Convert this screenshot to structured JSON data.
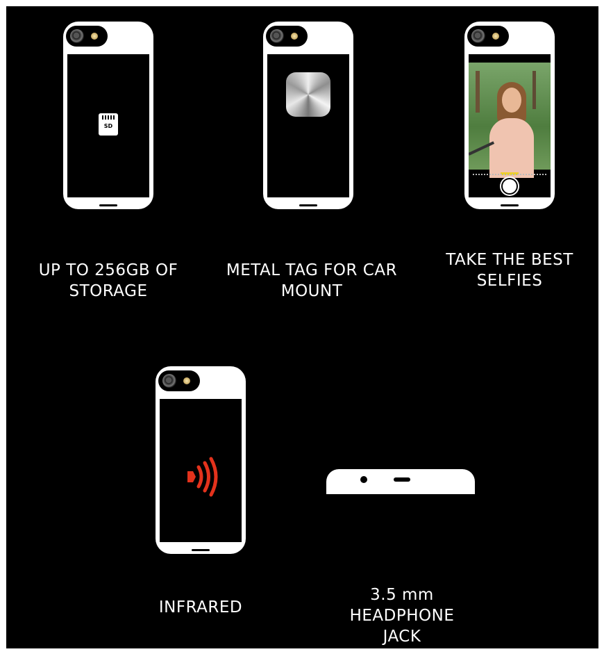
{
  "features": [
    {
      "caption_line1": "UP TO 256GB OF",
      "caption_line2": "STORAGE",
      "icon": "sd-card-icon",
      "sd_label": "SD"
    },
    {
      "caption_line1": "METAL TAG FOR CAR",
      "caption_line2": "MOUNT",
      "icon": "metal-tag-icon"
    },
    {
      "caption_line1": "TAKE THE BEST",
      "caption_line2": "SELFIES",
      "icon": "camera-selfie-screen"
    },
    {
      "caption_line1": "INFRARED",
      "icon": "infrared-signal-icon",
      "icon_color": "#e3321c"
    },
    {
      "caption_line1": "3.5 mm",
      "caption_line2": "HEADPHONE",
      "caption_line3": "JACK",
      "icon": "headphone-jack-icon"
    }
  ],
  "colors": {
    "background": "#000000",
    "phone": "#ffffff",
    "infrared": "#e3321c"
  }
}
